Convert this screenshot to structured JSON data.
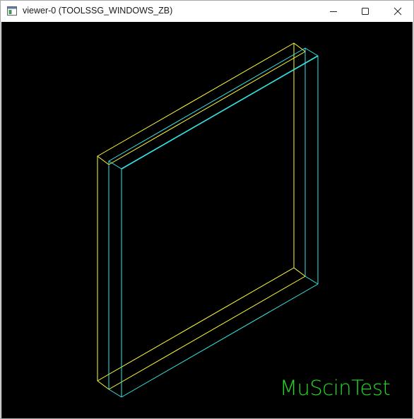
{
  "window": {
    "title": "viewer-0 (TOOLSSG_WINDOWS_ZB)",
    "controls": {
      "minimize": "minimize-icon",
      "maximize": "maximize-icon",
      "close": "close-icon"
    }
  },
  "viewer": {
    "background_color": "#000000",
    "scene_title": "MuScinTest",
    "scene_title_color": "#22d822",
    "volume_colors": {
      "outer": "#ffff33",
      "inner": "#33e6e6"
    }
  }
}
